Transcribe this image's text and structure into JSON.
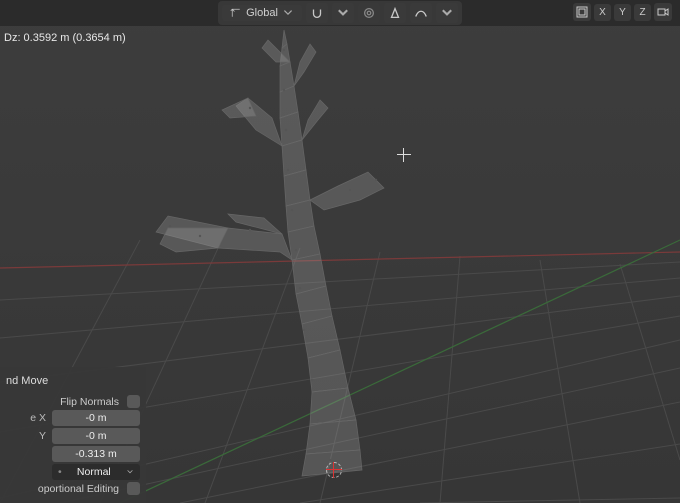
{
  "header": {
    "orientation_label": "Global",
    "axes": {
      "x": "X",
      "y": "Y",
      "z": "Z"
    }
  },
  "status": {
    "delta_text": "Dz: 0.3592 m (0.3654 m)"
  },
  "panel": {
    "title": "nd Move",
    "flip_normals_label": "Flip Normals",
    "flip_normals": false,
    "move": {
      "x_label": "e X",
      "y_label": "Y",
      "x": "-0 m",
      "y": "-0 m",
      "z": "-0.313 m"
    },
    "orientation_label": "Normal",
    "prop_edit_label": "oportional Editing",
    "prop_edit": false
  }
}
